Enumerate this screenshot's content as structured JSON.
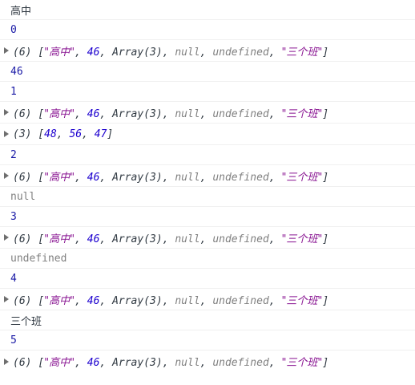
{
  "array_preview": {
    "length": "(6)",
    "open": "[",
    "close": "]",
    "item0": "\"高中\"",
    "item1": "46",
    "item2": "Array(3)",
    "item3": "null",
    "item4": "undefined",
    "item5": "\"三个班\"",
    "sep": ", "
  },
  "inner_array": {
    "length": "(3)",
    "open": "[",
    "close": "]",
    "v0": "48",
    "v1": "56",
    "v2": "47",
    "sep": ", "
  },
  "logs": {
    "l0": "高中",
    "l1": "0",
    "l3": "46",
    "l4": "1",
    "l7": "2",
    "l9": "null",
    "l10": "3",
    "l12": "undefined",
    "l13": "4",
    "l15": "三个班",
    "l16": "5"
  },
  "colors": {
    "string": "#881391",
    "number": "#1c00cf",
    "null_undefined": "#808080"
  }
}
